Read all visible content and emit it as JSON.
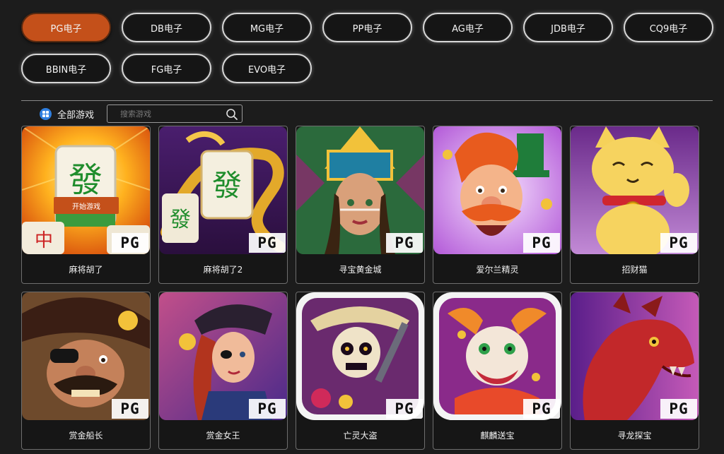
{
  "providers": [
    {
      "label": "PG电子",
      "active": true
    },
    {
      "label": "DB电子",
      "active": false
    },
    {
      "label": "MG电子",
      "active": false
    },
    {
      "label": "PP电子",
      "active": false
    },
    {
      "label": "AG电子",
      "active": false
    },
    {
      "label": "JDB电子",
      "active": false
    },
    {
      "label": "CQ9电子",
      "active": false
    },
    {
      "label": "BBIN电子",
      "active": false
    },
    {
      "label": "FG电子",
      "active": false
    },
    {
      "label": "EVO电子",
      "active": false
    }
  ],
  "filter": {
    "all_games_label": "全部游戏",
    "search_placeholder": "搜索游戏"
  },
  "play_label": "开始游戏",
  "badge_text": "PG",
  "games": [
    {
      "name": "麻将胡了",
      "art": "mahjong-tile"
    },
    {
      "name": "麻将胡了2",
      "art": "golden-dragon-tile"
    },
    {
      "name": "寻宝黄金城",
      "art": "aztec-princess"
    },
    {
      "name": "爱尔兰精灵",
      "art": "leprechaun"
    },
    {
      "name": "招财猫",
      "art": "lucky-cat"
    },
    {
      "name": "赏金船长",
      "art": "pirate-captain"
    },
    {
      "name": "赏金女王",
      "art": "pirate-queen"
    },
    {
      "name": "亡灵大盗",
      "art": "skeleton-bandit"
    },
    {
      "name": "麒麟送宝",
      "art": "qilin-dragon"
    },
    {
      "name": "寻龙探宝",
      "art": "red-dragon"
    }
  ],
  "colors": {
    "accent": "#c4501a",
    "background": "#1c1c1c"
  }
}
